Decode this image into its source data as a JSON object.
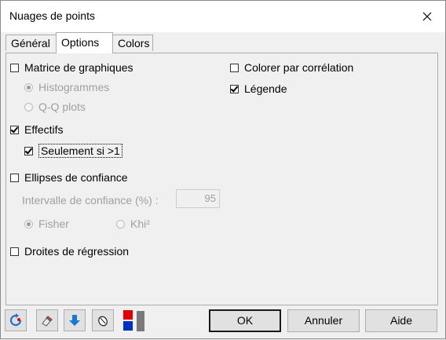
{
  "window": {
    "title": "Nuages de points"
  },
  "tabs": [
    {
      "label": "Général",
      "active": false
    },
    {
      "label": "Options",
      "active": true
    },
    {
      "label": "Colors",
      "active": false
    }
  ],
  "options": {
    "matrice": {
      "label": "Matrice de graphiques",
      "checked": false
    },
    "histogrammes": {
      "label": "Histogrammes",
      "selected": true,
      "enabled": false
    },
    "qqplots": {
      "label": "Q-Q plots",
      "selected": false,
      "enabled": false
    },
    "effectifs": {
      "label": "Effectifs",
      "checked": true
    },
    "seulement": {
      "label": "Seulement si >1",
      "checked": true
    },
    "ellipses": {
      "label": "Ellipses de confiance",
      "checked": false
    },
    "intervalle": {
      "label": "Intervalle de confiance (%) :",
      "value": "95",
      "enabled": false
    },
    "fisher": {
      "label": "Fisher",
      "selected": true,
      "enabled": false
    },
    "khi2": {
      "label": "Khi²",
      "selected": false,
      "enabled": false
    },
    "droites": {
      "label": "Droites de régression",
      "checked": false
    },
    "colorer": {
      "label": "Colorer par corrélation",
      "checked": false
    },
    "legende": {
      "label": "Légende",
      "checked": true
    }
  },
  "toolbar": {
    "icons": [
      "reset-icon",
      "eraser-icon",
      "down-arrow-icon",
      "mouse-icon",
      "color-swatch-icon"
    ]
  },
  "buttons": {
    "ok": "OK",
    "annuler": "Annuler",
    "aide": "Aide"
  },
  "colors": {
    "accent_blue": "#1976d2",
    "swatch_red": "#e00000",
    "swatch_blue": "#0030c0"
  }
}
